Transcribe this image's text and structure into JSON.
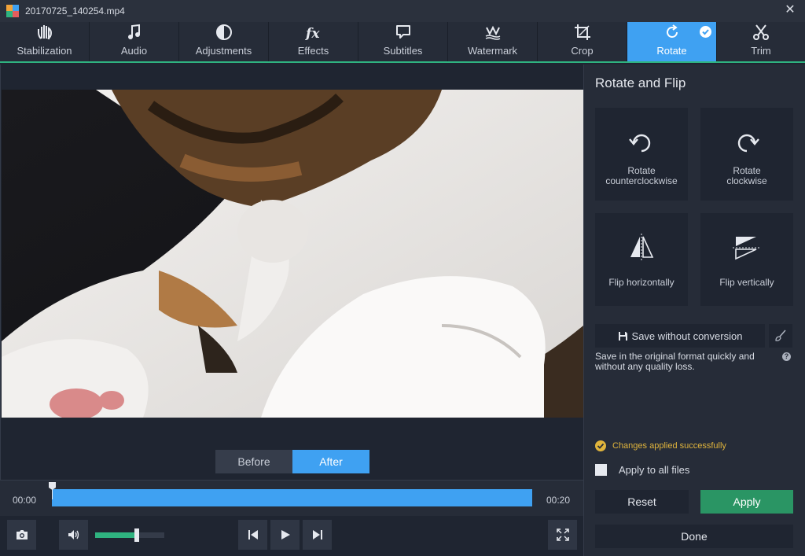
{
  "window": {
    "title": "20170725_140254.mp4",
    "close_icon": "close-icon"
  },
  "tabs": [
    {
      "label": "Stabilization",
      "icon": "hand-icon"
    },
    {
      "label": "Audio",
      "icon": "music-note-icon"
    },
    {
      "label": "Adjustments",
      "icon": "contrast-icon"
    },
    {
      "label": "Effects",
      "icon": "fx-icon"
    },
    {
      "label": "Subtitles",
      "icon": "speech-bubble-icon"
    },
    {
      "label": "Watermark",
      "icon": "watermark-icon"
    },
    {
      "label": "Crop",
      "icon": "crop-icon"
    },
    {
      "label": "Rotate",
      "icon": "rotate-icon",
      "active": true
    },
    {
      "label": "Trim",
      "icon": "scissors-icon"
    }
  ],
  "preview": {
    "before_label": "Before",
    "after_label": "After",
    "selected": "After"
  },
  "timeline": {
    "start_time": "00:00",
    "end_time": "00:20",
    "playhead_fraction": 0.0
  },
  "controls": {
    "snapshot_icon": "camera-icon",
    "volume_icon": "speaker-icon",
    "volume_level": 0.6,
    "prev_icon": "skip-back-icon",
    "play_icon": "play-icon",
    "next_icon": "skip-forward-icon",
    "fullscreen_icon": "fullscreen-icon"
  },
  "panel": {
    "title": "Rotate and Flip",
    "tools": [
      {
        "label_line1": "Rotate",
        "label_line2": "counterclockwise",
        "icon": "rotate-ccw-icon"
      },
      {
        "label_line1": "Rotate",
        "label_line2": "clockwise",
        "icon": "rotate-cw-icon"
      },
      {
        "label_line1": "Flip horizontally",
        "label_line2": "",
        "icon": "flip-horizontal-icon"
      },
      {
        "label_line1": "Flip vertically",
        "label_line2": "",
        "icon": "flip-vertical-icon"
      }
    ],
    "save_label": "Save without conversion",
    "note_line1": "Save in the original format quickly and",
    "note_line2": "without any quality loss.",
    "help_label": "?",
    "success_text": "Changes applied successfully",
    "apply_all_label": "Apply to all files",
    "reset_label": "Reset",
    "apply_label": "Apply",
    "done_label": "Done"
  },
  "colors": {
    "accent_blue": "#3fa1f2",
    "accent_green": "#2a9564",
    "success_yellow": "#e0b43c"
  }
}
